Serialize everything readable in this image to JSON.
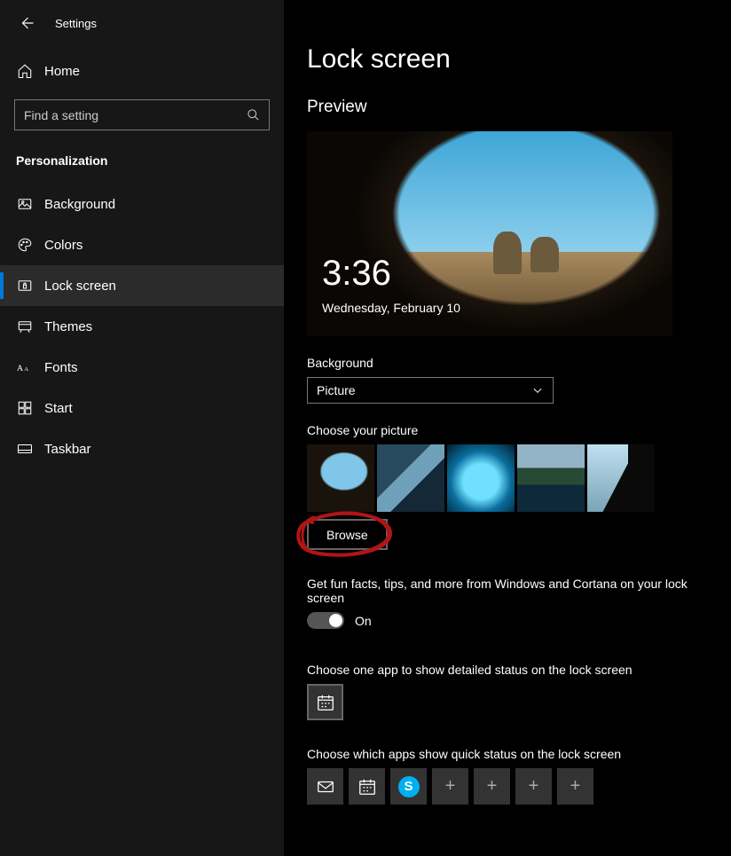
{
  "app_title": "Settings",
  "home_label": "Home",
  "search_placeholder": "Find a setting",
  "category": "Personalization",
  "nav": [
    {
      "label": "Background",
      "active": false
    },
    {
      "label": "Colors",
      "active": false
    },
    {
      "label": "Lock screen",
      "active": true
    },
    {
      "label": "Themes",
      "active": false
    },
    {
      "label": "Fonts",
      "active": false
    },
    {
      "label": "Start",
      "active": false
    },
    {
      "label": "Taskbar",
      "active": false
    }
  ],
  "page_title": "Lock screen",
  "preview": {
    "heading": "Preview",
    "time": "3:36",
    "date": "Wednesday, February 10"
  },
  "background_section": {
    "label": "Background",
    "selected": "Picture"
  },
  "choose_picture_label": "Choose your picture",
  "browse_label": "Browse",
  "fun_facts": {
    "label": "Get fun facts, tips, and more from Windows and Cortana on your lock screen",
    "state_label": "On",
    "on": true
  },
  "detailed_status_label": "Choose one app to show detailed status on the lock screen",
  "quick_status_label": "Choose which apps show quick status on the lock screen",
  "quick_status_slots": [
    "mail",
    "calendar",
    "skype",
    "add",
    "add",
    "add",
    "add"
  ],
  "annotation": {
    "target": "browse-button",
    "type": "circle",
    "color": "#b01515"
  }
}
